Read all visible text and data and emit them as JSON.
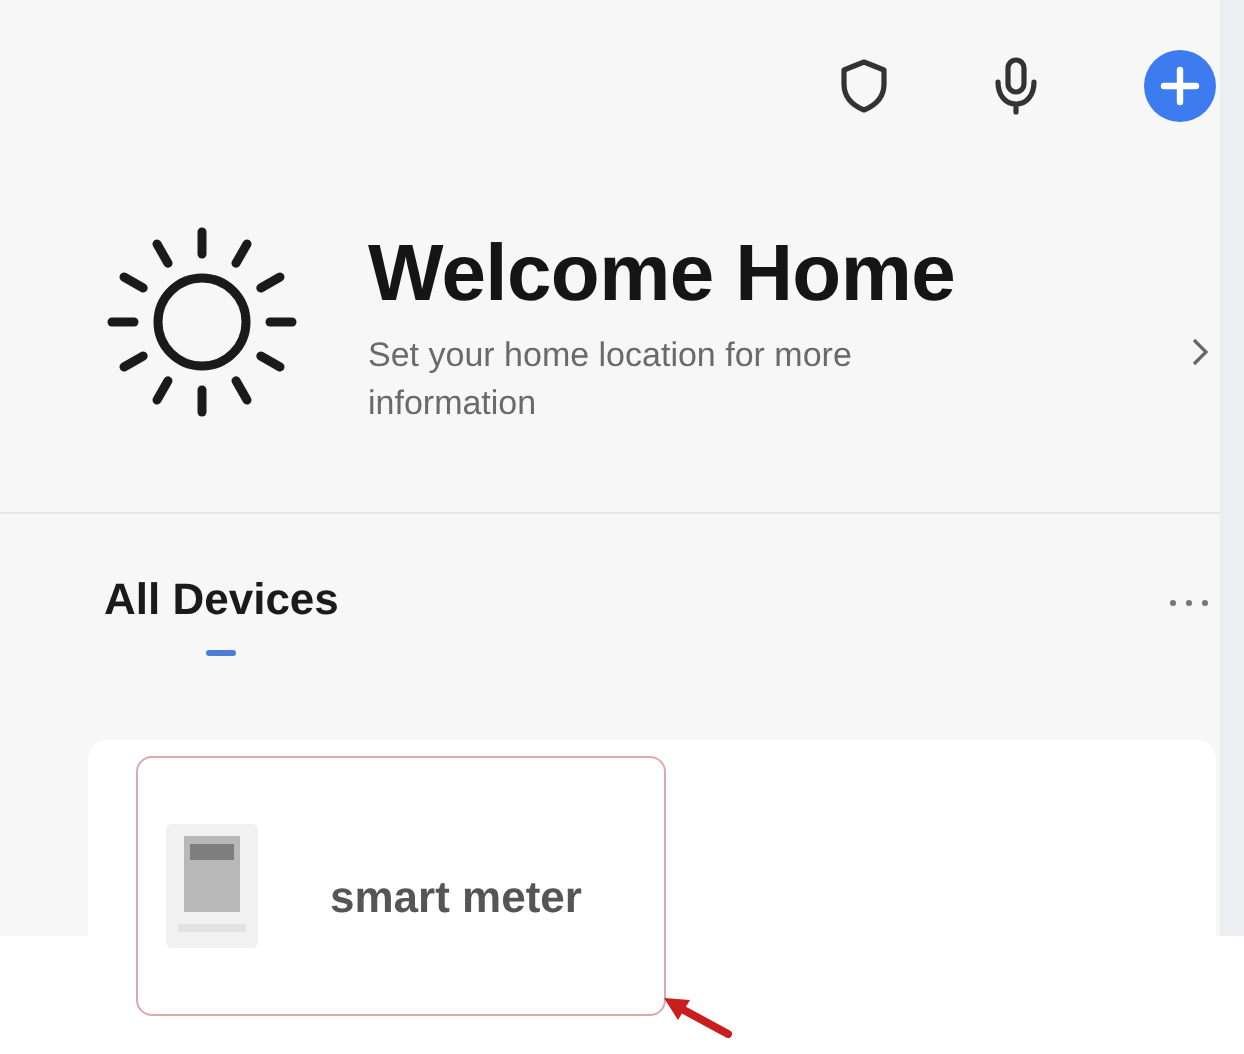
{
  "welcome": {
    "title": "Welcome Home",
    "subtitle": "Set your home location for more information"
  },
  "room_tabs": [
    {
      "label": "All Devices",
      "selected": true
    }
  ],
  "devices": [
    {
      "name": "smart meter",
      "highlighted": true
    }
  ]
}
